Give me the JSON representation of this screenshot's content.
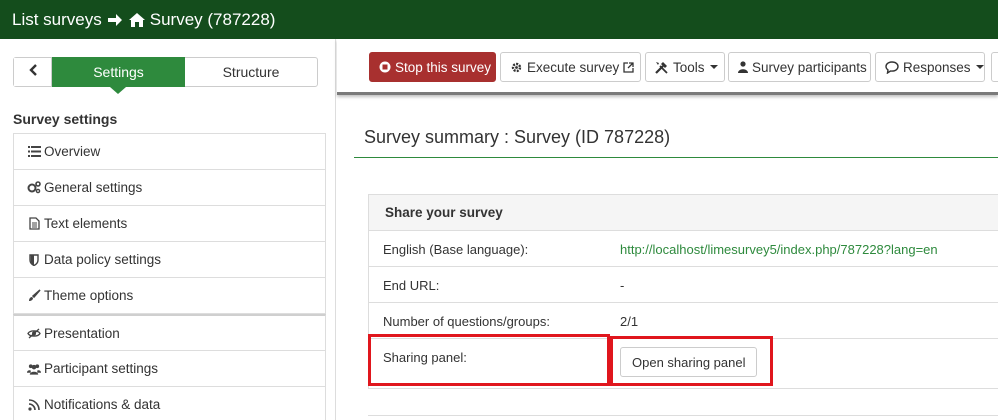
{
  "topbar": {
    "crumb_list": "List surveys",
    "crumb_survey": "Survey (787228)"
  },
  "sidebar": {
    "tabs": {
      "settings": "Settings",
      "structure": "Structure"
    },
    "section_title": "Survey settings",
    "items": [
      {
        "label": "Overview",
        "icon": "list-icon"
      },
      {
        "label": "General settings",
        "icon": "gears-icon"
      },
      {
        "label": "Text elements",
        "icon": "file-text-icon"
      },
      {
        "label": "Data policy settings",
        "icon": "shield-icon"
      },
      {
        "label": "Theme options",
        "icon": "paintbrush-icon"
      },
      {
        "label": "Presentation",
        "icon": "eye-slash-icon"
      },
      {
        "label": "Participant settings",
        "icon": "users-icon"
      },
      {
        "label": "Notifications & data",
        "icon": "rss-icon"
      }
    ]
  },
  "toolbar": {
    "stop": "Stop this survey",
    "execute": "Execute survey",
    "tools": "Tools",
    "participants": "Survey participants",
    "responses": "Responses"
  },
  "summary": {
    "title": "Survey summary : Survey (ID 787228)",
    "panel_title": "Share your survey",
    "rows": [
      {
        "key": "English (Base language):",
        "value": "http://localhost/limesurvey5/index.php/787228?lang=en"
      },
      {
        "key": "End URL:",
        "value": "-"
      },
      {
        "key": "Number of questions/groups:",
        "value": "2/1"
      },
      {
        "key": "Sharing panel:",
        "button": "Open sharing panel"
      }
    ]
  },
  "colors": {
    "topbar": "#144d1c",
    "accent": "#2e8a3d",
    "stop": "#a8302f",
    "highlight": "#e0161d"
  }
}
